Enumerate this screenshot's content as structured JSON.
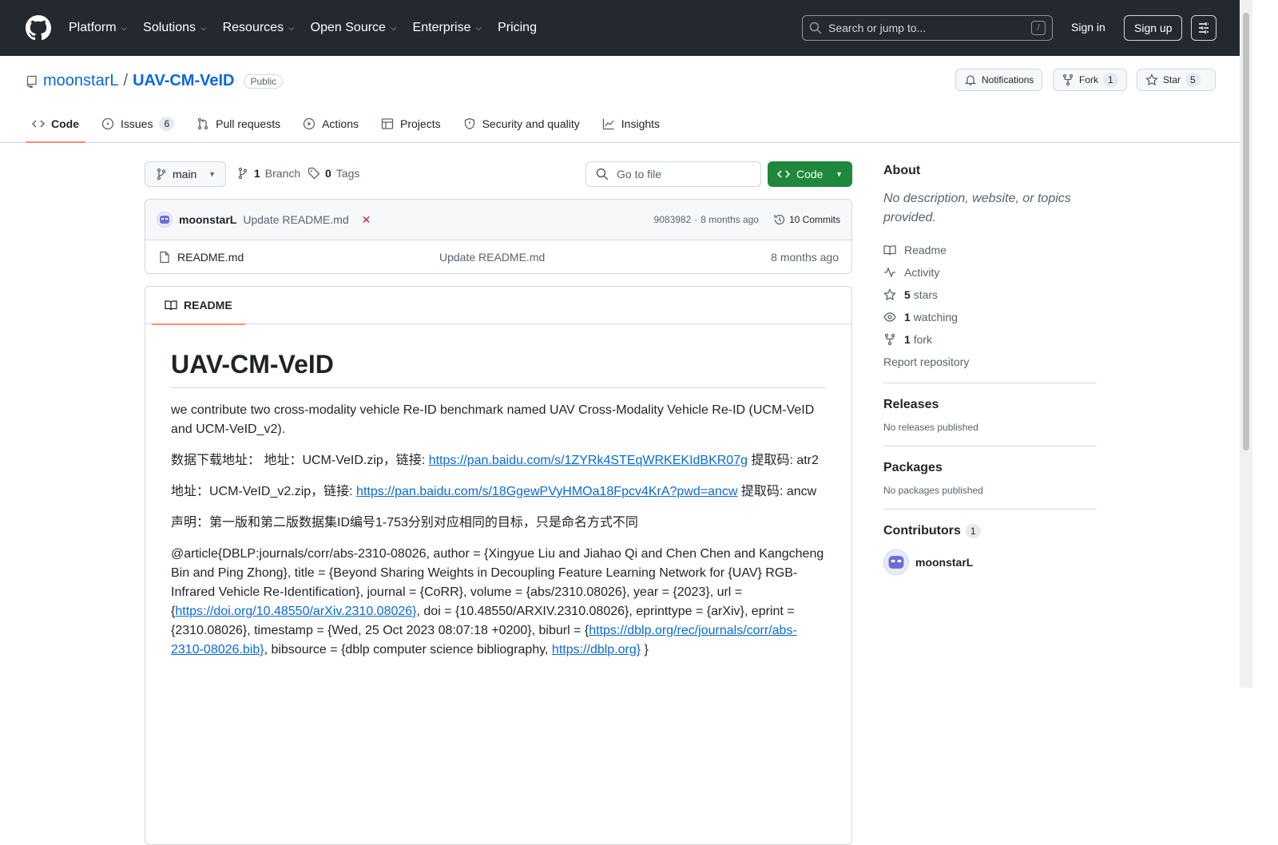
{
  "header": {
    "nav": [
      "Platform",
      "Solutions",
      "Resources",
      "Open Source",
      "Enterprise",
      "Pricing"
    ],
    "nav_has_chevron": [
      true,
      true,
      true,
      true,
      true,
      false
    ],
    "search_placeholder": "Search or jump to...",
    "search_shortcut": "/",
    "signin": "Sign in",
    "signup": "Sign up"
  },
  "repo": {
    "owner": "moonstarL",
    "separator": "/",
    "name": "UAV-CM-VeID",
    "visibility": "Public",
    "notifications": "Notifications",
    "fork_label": "Fork",
    "fork_count": "1",
    "star_label": "Star",
    "star_count": "5"
  },
  "tabs": [
    {
      "label": "Code",
      "icon": "code-icon"
    },
    {
      "label": "Issues",
      "icon": "issue-icon",
      "count": "6"
    },
    {
      "label": "Pull requests",
      "icon": "pull-request-icon"
    },
    {
      "label": "Actions",
      "icon": "play-icon"
    },
    {
      "label": "Projects",
      "icon": "table-icon"
    },
    {
      "label": "Security and quality",
      "icon": "shield-icon"
    },
    {
      "label": "Insights",
      "icon": "graph-icon"
    }
  ],
  "toolbar": {
    "branch": "main",
    "branch_count": "1",
    "branch_label": "Branch",
    "tag_count": "0",
    "tag_label": "Tags",
    "goto_placeholder": "Go to file",
    "code_button": "Code"
  },
  "commit": {
    "author": "moonstarL",
    "message": "Update README.md",
    "status": "✕",
    "sha": "9083982",
    "sep": "·",
    "time": "8 months ago",
    "commits": "10 Commits"
  },
  "files": [
    {
      "name": "README.md",
      "message": "Update README.md",
      "time": "8 months ago"
    }
  ],
  "readme": {
    "tab": "README",
    "title": "UAV-CM-VeID",
    "p1": "we contribute two cross-modality vehicle Re-ID benchmark named UAV Cross-Modality Vehicle Re-ID (UCM-VeID and UCM-VeID_v2).",
    "p2_prefix": "数据下载地址： 地址：UCM-VeID.zip，链接: ",
    "p2_link": "https://pan.baidu.com/s/1ZYRk4STEqWRKEKIdBKR07g",
    "p2_suffix": " 提取码: atr2",
    "p3_prefix": "地址：UCM-VeID_v2.zip，链接: ",
    "p3_link": "https://pan.baidu.com/s/18GgewPVyHMOa18Fpcv4KrA?pwd=ancw",
    "p3_suffix": " 提取码: ancw",
    "p4": "声明：第一版和第二版数据集ID编号1-753分别对应相同的目标，只是命名方式不同",
    "p5_a": "@article{DBLP:journals/corr/abs-2310-08026, author = {Xingyue Liu and Jiahao Qi and Chen Chen and Kangcheng Bin and Ping Zhong}, title = {Beyond Sharing Weights in Decoupling Feature Learning Network for {UAV} RGB-Infrared Vehicle Re-Identification}, journal = {CoRR}, volume = {abs/2310.08026}, year = {2023}, url = {",
    "p5_link1": "https://doi.org/10.48550/arXiv.2310.08026}",
    "p5_b": ", doi = {10.48550/ARXIV.2310.08026}, eprinttype = {arXiv}, eprint = {2310.08026}, timestamp = {Wed, 25 Oct 2023 08:07:18 +0200}, biburl = {",
    "p5_link2": "https://dblp.org/rec/journals/corr/abs-2310-08026.bib}",
    "p5_c": ", bibsource = {dblp computer science bibliography, ",
    "p5_link3": "https://dblp.org}",
    "p5_d": " }"
  },
  "sidebar": {
    "about_title": "About",
    "about_desc": "No description, website, or topics provided.",
    "readme": "Readme",
    "activity": "Activity",
    "stars_n": "5",
    "stars": "stars",
    "watching_n": "1",
    "watching": "watching",
    "fork_n": "1",
    "fork": "fork",
    "report": "Report repository",
    "releases_title": "Releases",
    "releases_empty": "No releases published",
    "packages_title": "Packages",
    "packages_empty": "No packages published",
    "contributors_title": "Contributors",
    "contributors_count": "1",
    "contributor": "moonstarL"
  },
  "colors": {
    "header_bg": "#24292f",
    "link": "#0969da",
    "code_button": "#1f883d",
    "tab_underline": "#fd8c73",
    "fail": "#cf222e"
  }
}
